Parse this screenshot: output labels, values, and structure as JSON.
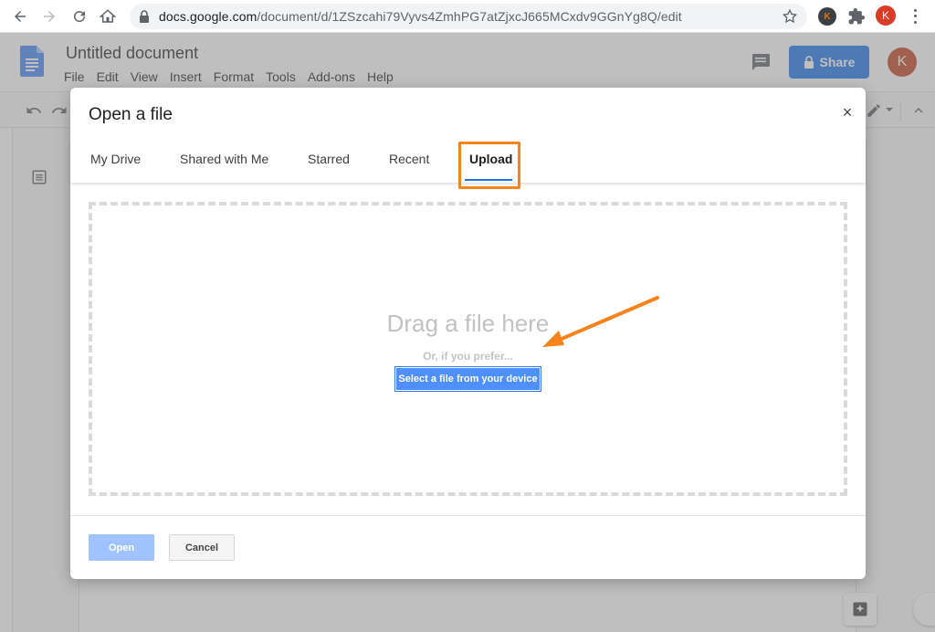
{
  "browser": {
    "url_host": "docs.google.com",
    "url_path": "/document/d/1ZSzcahi79Vyvs4ZmhPG7atZjxcJ665MCxdv9GGnYg8Q/edit",
    "extension_initial": "K",
    "profile_initial": "K",
    "icons": [
      "back-icon",
      "forward-icon",
      "reload-icon",
      "home-icon",
      "lock-icon",
      "star-icon",
      "puzzle-icon",
      "menu-dots-icon"
    ]
  },
  "docs": {
    "title": "Untitled document",
    "menu": [
      "File",
      "Edit",
      "View",
      "Insert",
      "Format",
      "Tools",
      "Add-ons",
      "Help"
    ],
    "share_label": "Share",
    "avatar_initial": "K",
    "share_color": "#1a73e8"
  },
  "dialog": {
    "title": "Open a file",
    "close_label": "×",
    "tabs": [
      {
        "label": "My Drive",
        "active": false
      },
      {
        "label": "Shared with Me",
        "active": false
      },
      {
        "label": "Starred",
        "active": false
      },
      {
        "label": "Recent",
        "active": false
      },
      {
        "label": "Upload",
        "active": true
      }
    ],
    "drop_title": "Drag a file here",
    "drop_subtitle": "Or, if you prefer...",
    "select_button": "Select a file from your device",
    "open_button": "Open",
    "cancel_button": "Cancel",
    "annotation_color": "#f5841f"
  }
}
